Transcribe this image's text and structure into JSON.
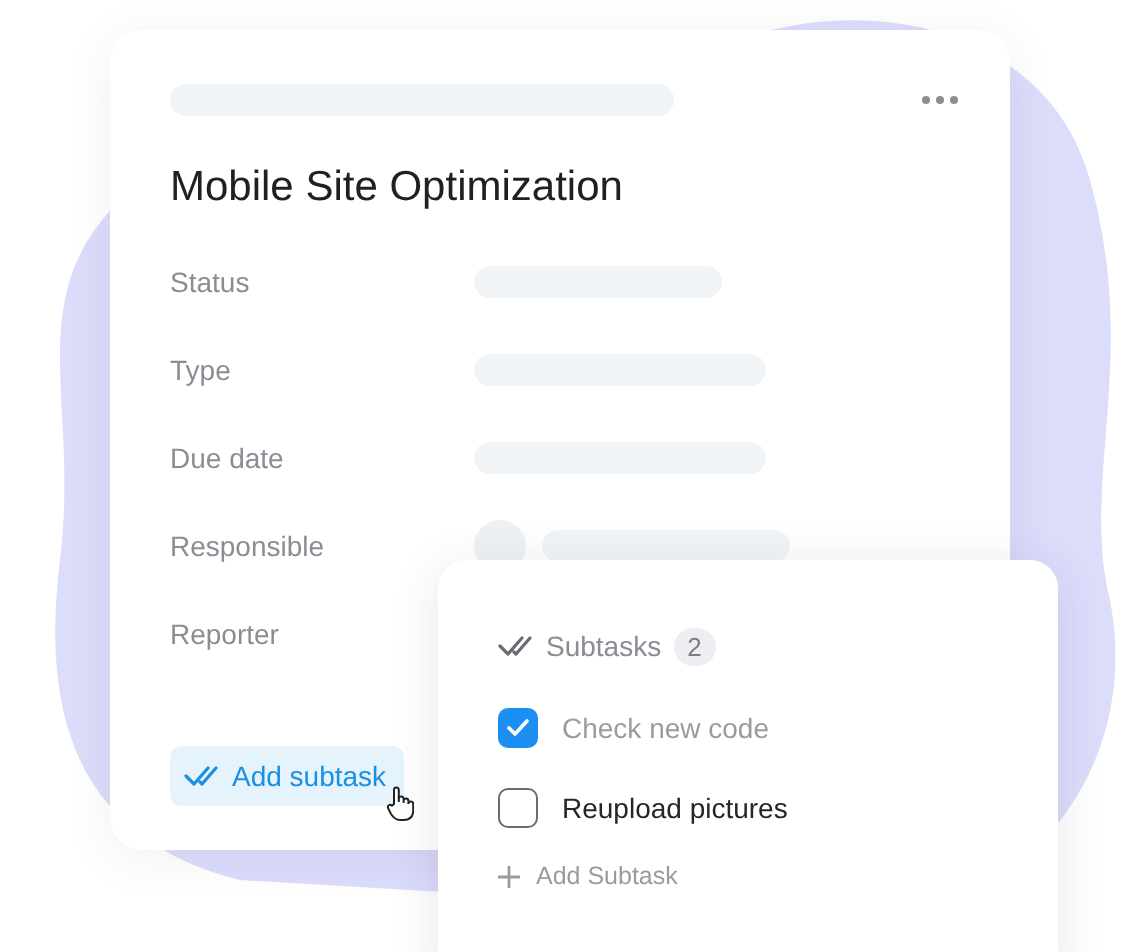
{
  "task": {
    "title": "Mobile Site Optimization",
    "fields": [
      {
        "label": "Status",
        "kind": "text"
      },
      {
        "label": "Type",
        "kind": "text"
      },
      {
        "label": "Due date",
        "kind": "text"
      },
      {
        "label": "Responsible",
        "kind": "person"
      },
      {
        "label": "Reporter",
        "kind": "empty"
      }
    ],
    "add_button": "Add subtask"
  },
  "subtasks": {
    "title": "Subtasks",
    "count": "2",
    "items": [
      {
        "label": "Check new code",
        "checked": true
      },
      {
        "label": "Reupload pictures",
        "checked": false
      }
    ],
    "add_label": "Add Subtask"
  }
}
